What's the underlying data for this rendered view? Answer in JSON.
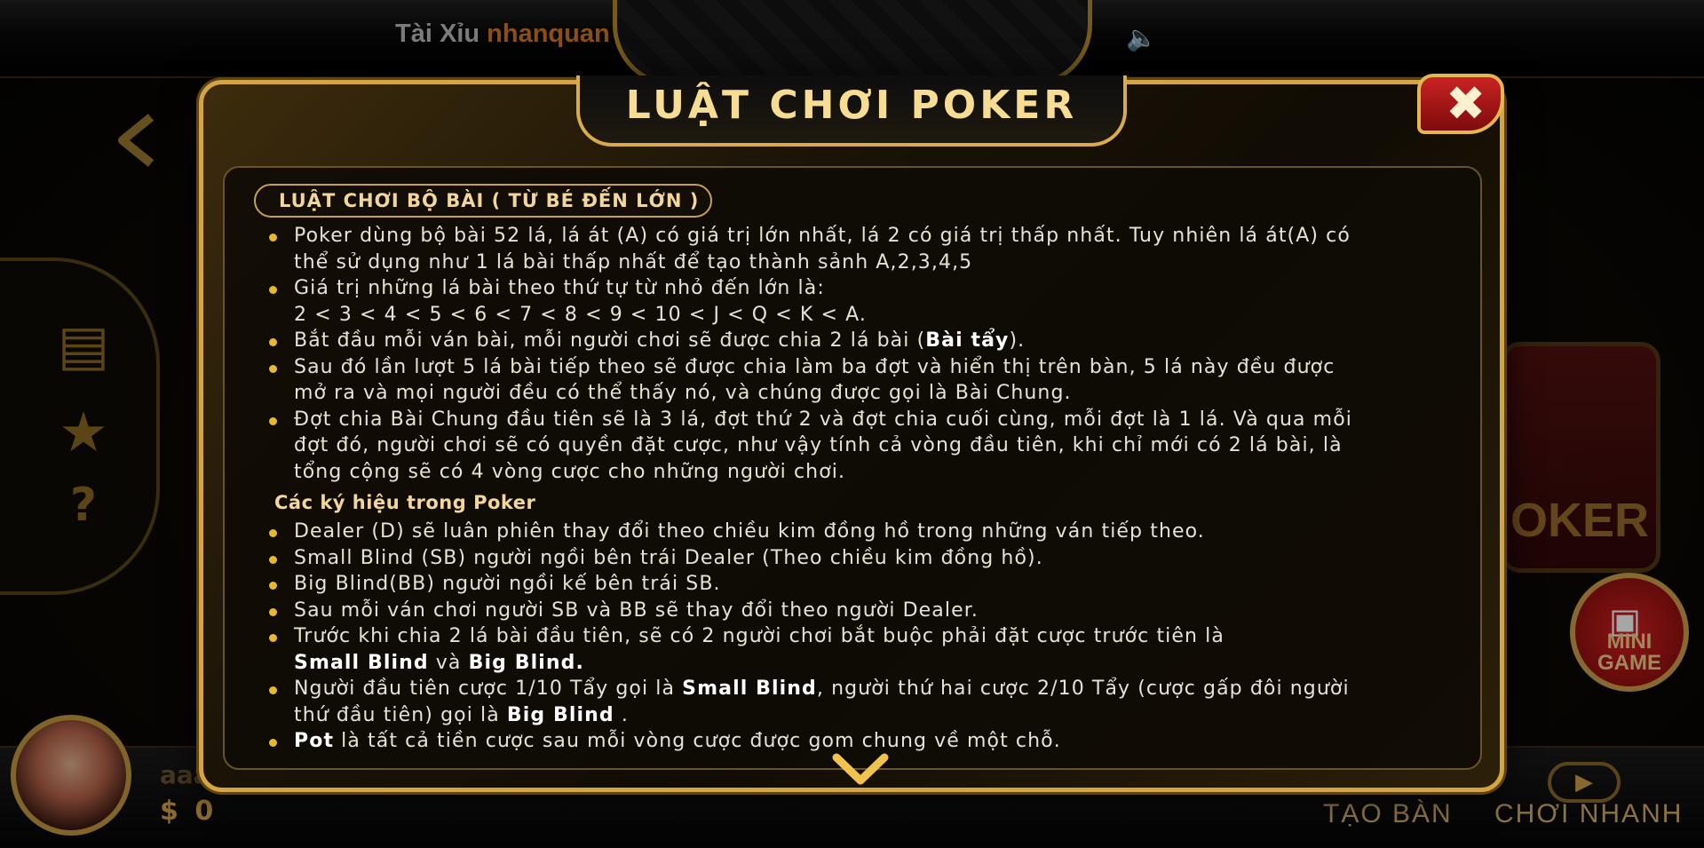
{
  "header": {
    "marquee_prefix": "Tài Xỉu",
    "marquee_user": "nhanquan"
  },
  "player": {
    "name": "aaa",
    "money": "$ 0"
  },
  "bottom_actions": {
    "create_table": "TẠO BÀN",
    "quick_play": "CHƠI NHANH"
  },
  "mini_game": {
    "line1": "MINI",
    "line2": "GAME"
  },
  "background": {
    "card_label": "OKER"
  },
  "dialog": {
    "title": "LUẬT CHƠI POKER",
    "section1_title": "LUẬT CHƠI BỘ BÀI ( TỪ BÉ ĐẾN LỚN )",
    "rules": {
      "r1a": "Poker dùng bộ bài 52 lá, lá át (A) có giá trị lớn nhất, lá 2 có giá trị thấp nhất. Tuy nhiên lá át(A) có",
      "r1b": "thể sử dụng như 1 lá bài thấp nhất để tạo thành sảnh A,2,3,4,5",
      "r2a": "Giá trị những lá bài theo thứ tự từ nhỏ đến lớn là:",
      "r2b": "2 < 3 < 4 < 5 < 6 < 7 < 8 < 9 < 10 < J < Q < K < A.",
      "r3_text": "Bắt đầu mỗi ván bài, mỗi người chơi sẽ được chia 2 lá bài (",
      "r3_bold": "Bài tẩy",
      "r3_end": ").",
      "r4a": "Sau đó lần lượt 5 lá bài tiếp theo sẽ được chia làm ba đợt và hiển thị trên bàn, 5 lá này đều được",
      "r4b": "mở ra và mọi người đều có thể thấy nó, và chúng được gọi là Bài Chung.",
      "r5a": "Đợt chia Bài Chung đầu tiên sẽ là 3 lá, đợt thứ 2 và đợt chia cuối cùng, mỗi đợt là 1 lá. Và qua mỗi",
      "r5b": "đợt đó, người chơi sẽ có quyền đặt cược, như vậy tính cả vòng đầu tiên, khi chỉ mới có 2 lá bài, là",
      "r5c": "tổng cộng sẽ có 4 vòng cược cho những người chơi."
    },
    "section2_title": "Các ký hiệu trong Poker",
    "symbols": {
      "s1": "Dealer (D) sẽ luân phiên thay đổi theo chiều kim đồng hồ trong những ván tiếp theo.",
      "s2": "Small Blind (SB) người ngồi bên trái Dealer (Theo chiều kim đồng hồ).",
      "s3": "Big Blind(BB) người ngồi kế bên trái SB.",
      "s4": "Sau mỗi ván chơi người SB và BB sẽ thay đổi theo người Dealer.",
      "s5a": "Trước khi chia 2 lá bài đầu tiên, sẽ có 2 người chơi bắt buộc phải đặt cược trước tiên là",
      "s5b_bold1": "Small Blind",
      "s5b_mid": " và ",
      "s5b_bold2": "Big Blind.",
      "s6a_text": "Người đầu tiên cược 1/10 Tẩy gọi là ",
      "s6a_bold": "Small Blind",
      "s6a_end": ", người thứ hai cược 2/10 Tẩy (cược gấp đôi người",
      "s6b_text": "thứ đầu tiên) gọi là ",
      "s6b_bold": "Big Blind",
      "s6b_end": " .",
      "s7_bold": "Pot",
      "s7_text": " là tất cả tiền cược sau mỗi vòng cược được gom chung về một chỗ."
    }
  },
  "colors": {
    "gold": "#d4a542",
    "accent_orange": "#d47a1f",
    "bullet": "#e8b830",
    "close_red": "#c92222"
  },
  "icons": [
    "back-arrow-icon",
    "document-icon",
    "trophy-icon",
    "help-icon",
    "speaker-icon",
    "close-icon",
    "scroll-down-icon",
    "gamepad-icon",
    "play-icon"
  ]
}
